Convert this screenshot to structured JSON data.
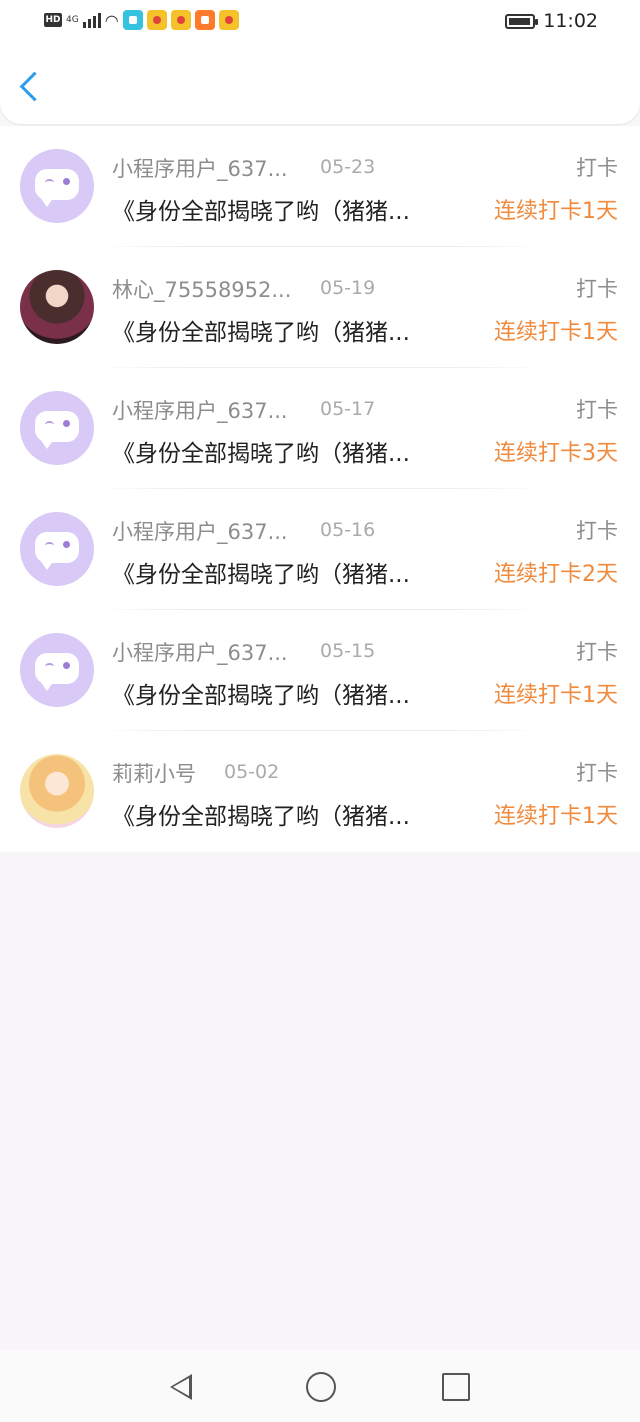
{
  "status_bar": {
    "network_badge": "HD",
    "network_type": "4G",
    "time": "11:02"
  },
  "header": {
    "back_icon": "chevron-left-icon"
  },
  "colors": {
    "accent": "#2a9df0",
    "streak": "#f08a3c",
    "chat_avatar_bg": "#d9c9f7"
  },
  "entries": [
    {
      "name": "小程序用户_637...",
      "date": "05-23",
      "type": "打卡",
      "title": "《身份全部揭晓了哟（猪猪...",
      "streak": "连续打卡1天",
      "avatar": "chat-bubble-avatar"
    },
    {
      "name": "林心_75558952...",
      "date": "05-19",
      "type": "打卡",
      "title": "《身份全部揭晓了哟（猪猪...",
      "streak": "连续打卡1天",
      "avatar": "anime-girl-avatar"
    },
    {
      "name": "小程序用户_637...",
      "date": "05-17",
      "type": "打卡",
      "title": "《身份全部揭晓了哟（猪猪...",
      "streak": "连续打卡3天",
      "avatar": "chat-bubble-avatar"
    },
    {
      "name": "小程序用户_637...",
      "date": "05-16",
      "type": "打卡",
      "title": "《身份全部揭晓了哟（猪猪...",
      "streak": "连续打卡2天",
      "avatar": "chat-bubble-avatar"
    },
    {
      "name": "小程序用户_637...",
      "date": "05-15",
      "type": "打卡",
      "title": "《身份全部揭晓了哟（猪猪...",
      "streak": "连续打卡1天",
      "avatar": "chat-bubble-avatar"
    },
    {
      "name": "莉莉小号",
      "date": "05-02",
      "type": "打卡",
      "title": "《身份全部揭晓了哟（猪猪...",
      "streak": "连续打卡1天",
      "avatar": "anime-girl-avatar"
    }
  ]
}
